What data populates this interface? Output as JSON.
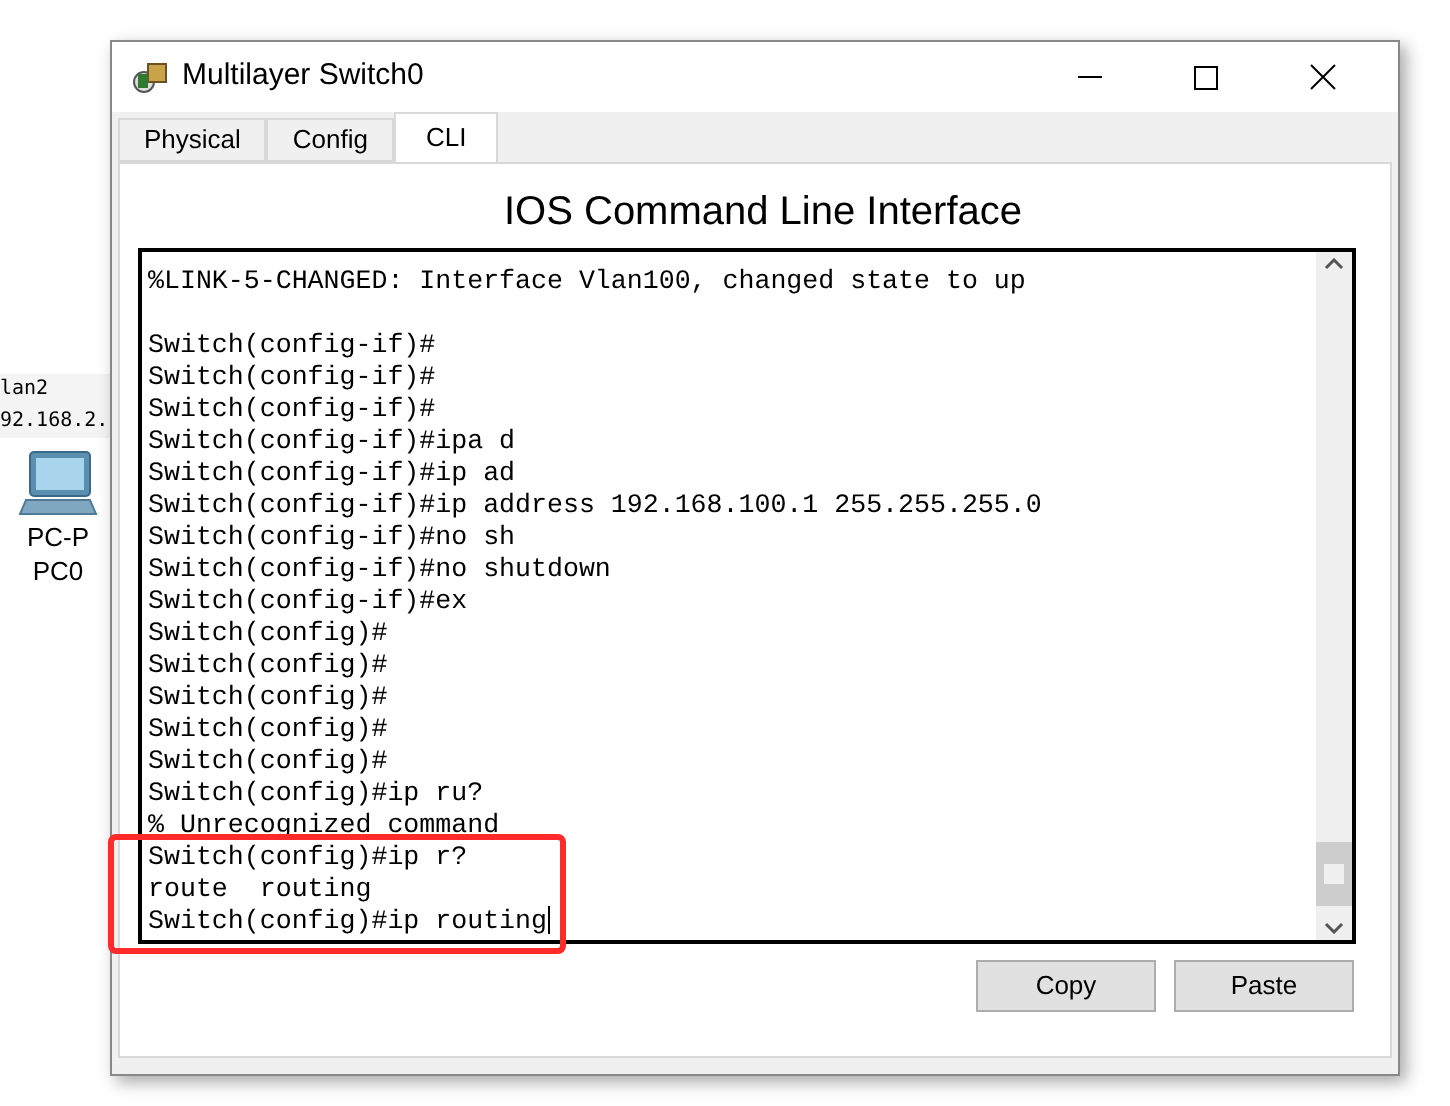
{
  "canvas": {
    "labels": [
      "lan2",
      "92.168.2."
    ],
    "device": {
      "labels": [
        "PC-P",
        "PC0"
      ]
    }
  },
  "window": {
    "title": "Multilayer Switch0"
  },
  "tabs": [
    {
      "label": "Physical",
      "selected": false
    },
    {
      "label": "Config",
      "selected": false
    },
    {
      "label": "CLI",
      "selected": true
    }
  ],
  "heading": "IOS Command Line Interface",
  "terminal": {
    "blocks": [
      [
        "%LINK-5-CHANGED: Interface Vlan100, changed state to up"
      ],
      [
        "Switch(config-if)#",
        "Switch(config-if)#",
        "Switch(config-if)#",
        "Switch(config-if)#ipa d",
        "Switch(config-if)#ip ad",
        "Switch(config-if)#ip address 192.168.100.1 255.255.255.0",
        "Switch(config-if)#no sh",
        "Switch(config-if)#no shutdown",
        "Switch(config-if)#ex",
        "Switch(config)#",
        "Switch(config)#",
        "Switch(config)#",
        "Switch(config)#",
        "Switch(config)#",
        "Switch(config)#ip ru?",
        "% Unrecognized command",
        "Switch(config)#ip r?",
        "route  routing",
        "Switch(config)#ip routing"
      ]
    ]
  },
  "buttons": [
    "Copy",
    "Paste"
  ]
}
